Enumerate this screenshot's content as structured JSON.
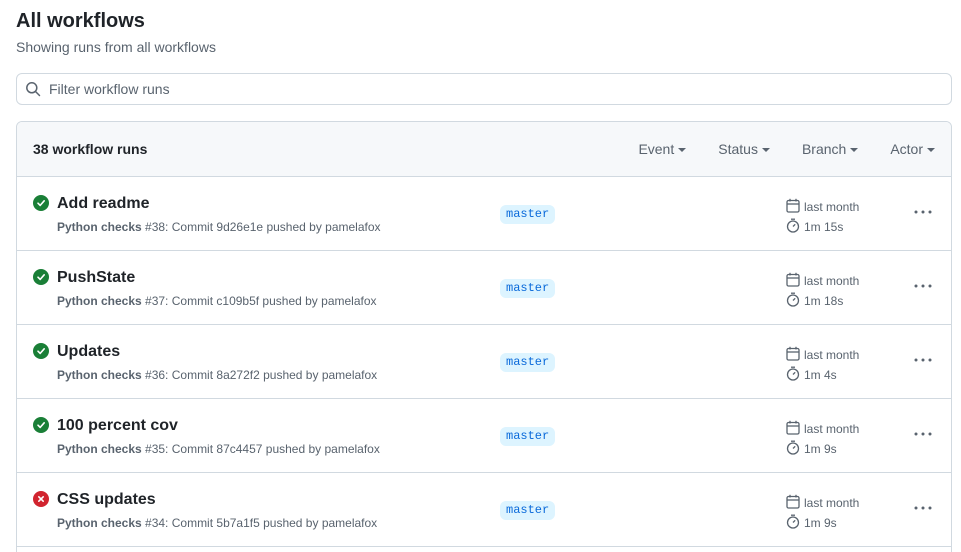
{
  "header": {
    "title": "All workflows",
    "subtitle": "Showing runs from all workflows"
  },
  "search": {
    "placeholder": "Filter workflow runs",
    "value": ""
  },
  "runs_header": {
    "count_label": "38 workflow runs",
    "filters": [
      "Event",
      "Status",
      "Branch",
      "Actor"
    ]
  },
  "colors": {
    "success": "#1a7f37",
    "failure": "#d1242f",
    "branch_bg": "#ddf4ff",
    "branch_text": "#0969da"
  },
  "runs": [
    {
      "status": "success",
      "title": "Add readme",
      "workflow": "Python checks",
      "meta": " #38: Commit 9d26e1e pushed by pamelafox",
      "branch": "master",
      "when": "last month",
      "duration": "1m 15s"
    },
    {
      "status": "success",
      "title": "PushState",
      "workflow": "Python checks",
      "meta": " #37: Commit c109b5f pushed by pamelafox",
      "branch": "master",
      "when": "last month",
      "duration": "1m 18s"
    },
    {
      "status": "success",
      "title": "Updates",
      "workflow": "Python checks",
      "meta": " #36: Commit 8a272f2 pushed by pamelafox",
      "branch": "master",
      "when": "last month",
      "duration": "1m 4s"
    },
    {
      "status": "success",
      "title": "100 percent cov",
      "workflow": "Python checks",
      "meta": " #35: Commit 87c4457 pushed by pamelafox",
      "branch": "master",
      "when": "last month",
      "duration": "1m 9s"
    },
    {
      "status": "failure",
      "title": "CSS updates",
      "workflow": "Python checks",
      "meta": " #34: Commit 5b7a1f5 pushed by pamelafox",
      "branch": "master",
      "when": "last month",
      "duration": "1m 9s"
    }
  ]
}
